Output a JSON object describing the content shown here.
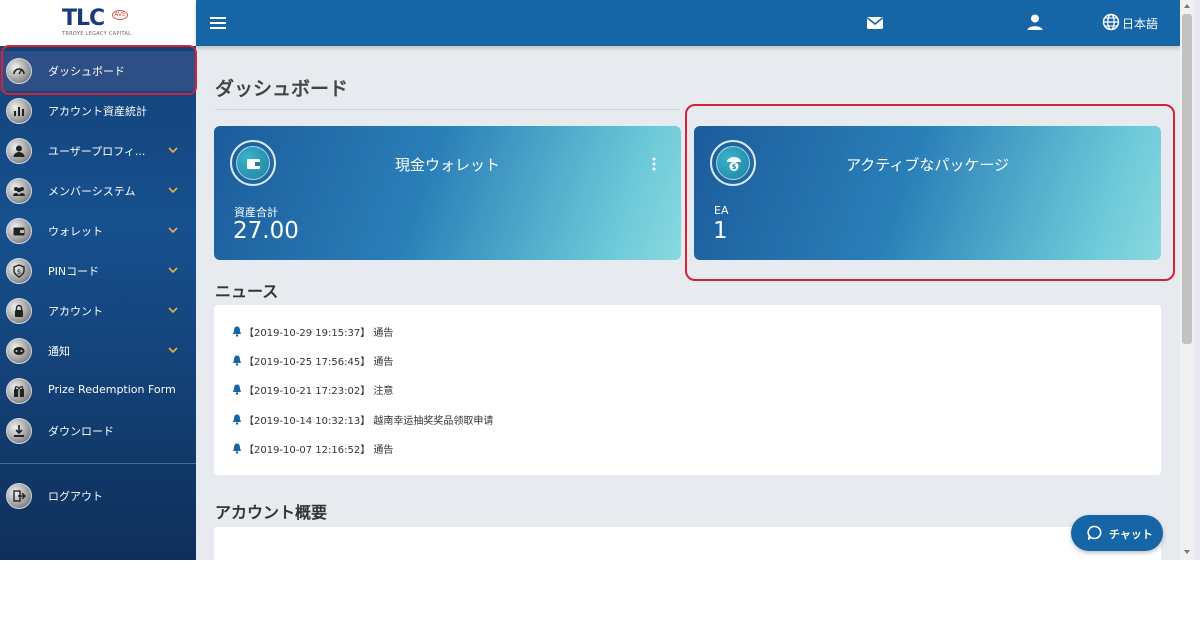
{
  "logo": {
    "text": "TLC",
    "badge": "AVE",
    "sub": "TRROYE LEGACY CAPITAL"
  },
  "sidebar": {
    "items": [
      {
        "label": "ダッシュボード",
        "icon": "dashboard-icon",
        "expandable": false
      },
      {
        "label": "アカウント資産統計",
        "icon": "bar-chart-icon",
        "expandable": false
      },
      {
        "label": "ユーザープロフィ...",
        "icon": "user-icon",
        "expandable": true
      },
      {
        "label": "メンバーシステム",
        "icon": "members-icon",
        "expandable": true
      },
      {
        "label": "ウォレット",
        "icon": "wallet-icon",
        "expandable": true
      },
      {
        "label": "PINコード",
        "icon": "pin-icon",
        "expandable": true
      },
      {
        "label": "アカウント",
        "icon": "lock-icon",
        "expandable": true
      },
      {
        "label": "通知",
        "icon": "notification-icon",
        "expandable": true
      },
      {
        "label": "Prize Redemption Form",
        "icon": "gift-icon",
        "expandable": false
      },
      {
        "label": "ダウンロード",
        "icon": "download-icon",
        "expandable": false
      }
    ],
    "logout_label": "ログアウト"
  },
  "header": {
    "language": "日本語"
  },
  "main": {
    "title": "ダッシュボード",
    "wallet_card": {
      "title": "現金ウォレット",
      "sublabel": "資産合計",
      "value": "27.00"
    },
    "package_card": {
      "title": "アクティブなパッケージ",
      "sublabel": "EA",
      "value": "1"
    },
    "news_title": "ニュース",
    "news": [
      "【2019-10-29 19:15:37】 通告",
      "【2019-10-25 17:56:45】 通告",
      "【2019-10-21 17:23:02】 注意",
      "【2019-10-14 10:32:13】 越南幸运抽奖奖品领取申请",
      "【2019-10-07 12:16:52】 通告"
    ],
    "summary_title": "アカウント概要"
  },
  "chat": {
    "label": "チャット"
  },
  "colors": {
    "header": "#1565a7",
    "sidebar": "#17508f",
    "highlight": "#d1233a",
    "card_start": "#1c5c9c",
    "card_end": "#8ad9e0"
  }
}
